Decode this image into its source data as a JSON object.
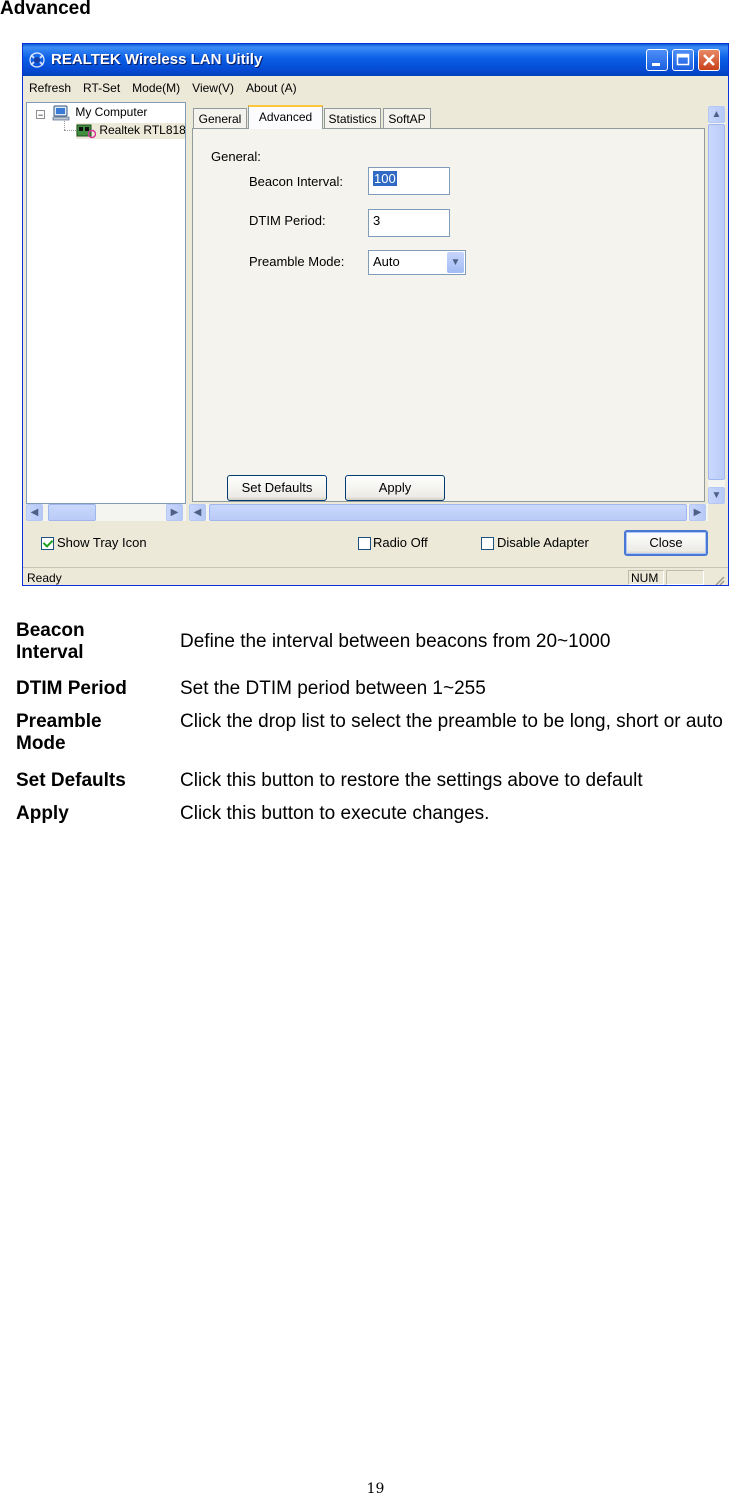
{
  "heading": "Advanced",
  "window": {
    "title": "REALTEK Wireless LAN Uitily",
    "controls": [
      "minimize",
      "maximize",
      "close"
    ],
    "menu": [
      "Refresh",
      "RT-Set",
      "Mode(M)",
      "View(V)",
      "About (A)"
    ]
  },
  "tree": {
    "root": "My Computer",
    "child": "Realtek RTL818"
  },
  "tabs": [
    "General",
    "Advanced",
    "Statistics",
    "SoftAP"
  ],
  "active_tab": "Advanced",
  "advanced": {
    "group_label": "General:",
    "beacon_label": "Beacon Interval:",
    "beacon_value": "100",
    "dtim_label": "DTIM Period:",
    "dtim_value": "3",
    "preamble_label": "Preamble Mode:",
    "preamble_value": "Auto",
    "set_defaults": "Set Defaults",
    "apply": "Apply"
  },
  "bottom": {
    "show_tray": "Show Tray Icon",
    "show_tray_checked": true,
    "radio_off": "Radio Off",
    "radio_off_checked": false,
    "disable_adapter": "Disable Adapter",
    "disable_adapter_checked": false,
    "close": "Close"
  },
  "statusbar": {
    "text": "Ready",
    "num": "NUM"
  },
  "descriptions": [
    {
      "term": "Beacon Interval",
      "text": "Define the interval between beacons from 20~1000"
    },
    {
      "term": "DTIM Period",
      "text": "Set the DTIM period between 1~255"
    },
    {
      "term": "Preamble Mode",
      "text": "Click the drop list to select the preamble to be long, short or auto"
    },
    {
      "term": "Set Defaults",
      "text": "Click this button to restore the settings above to default"
    },
    {
      "term": "Apply",
      "text": "Click this button to execute changes."
    }
  ],
  "page_number": "19"
}
